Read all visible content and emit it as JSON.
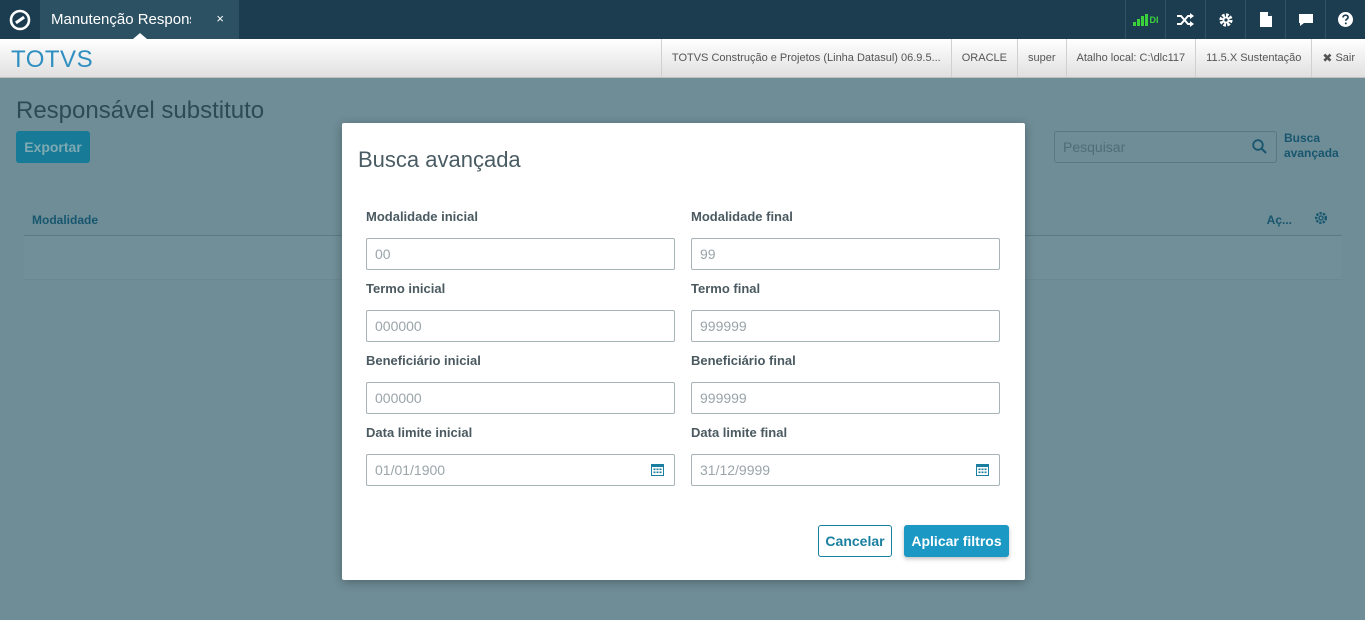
{
  "topbar": {
    "tab_label": "Manutenção Responsável",
    "tab_close": "×",
    "signal_label": "DI"
  },
  "header": {
    "brand": "TOTVS",
    "product": "TOTVS Construção e Projetos (Linha Datasul) 06.9.5...",
    "database": "ORACLE",
    "user": "super",
    "shortcut": "Atalho local: C:\\dlc117",
    "version": "11.5.X Sustentação",
    "exit": "Sair"
  },
  "page": {
    "title": "Responsável substituto",
    "export_label": "Exportar",
    "search_placeholder": "Pesquisar",
    "advanced_link": "Busca avançada",
    "col_modalidade": "Modalidade",
    "col_acoes": "Aç..."
  },
  "modal": {
    "title": "Busca avançada",
    "fields": {
      "modalidade_inicial": {
        "label": "Modalidade inicial",
        "value": "00"
      },
      "modalidade_final": {
        "label": "Modalidade final",
        "value": "99"
      },
      "termo_inicial": {
        "label": "Termo inicial",
        "value": "000000"
      },
      "termo_final": {
        "label": "Termo final",
        "value": "999999"
      },
      "beneficiario_inicial": {
        "label": "Beneficiário inicial",
        "value": "000000"
      },
      "beneficiario_final": {
        "label": "Beneficiário final",
        "value": "999999"
      },
      "data_limite_inicial": {
        "label": "Data limite inicial",
        "value": "01/01/1900"
      },
      "data_limite_final": {
        "label": "Data limite final",
        "value": "31/12/9999"
      }
    },
    "cancel_label": "Cancelar",
    "apply_label": "Aplicar filtros"
  },
  "colors": {
    "topbar": "#1c3d4f",
    "brand": "#2f8fc0",
    "primary": "#1b98c4",
    "signal": "#3bd13b"
  }
}
